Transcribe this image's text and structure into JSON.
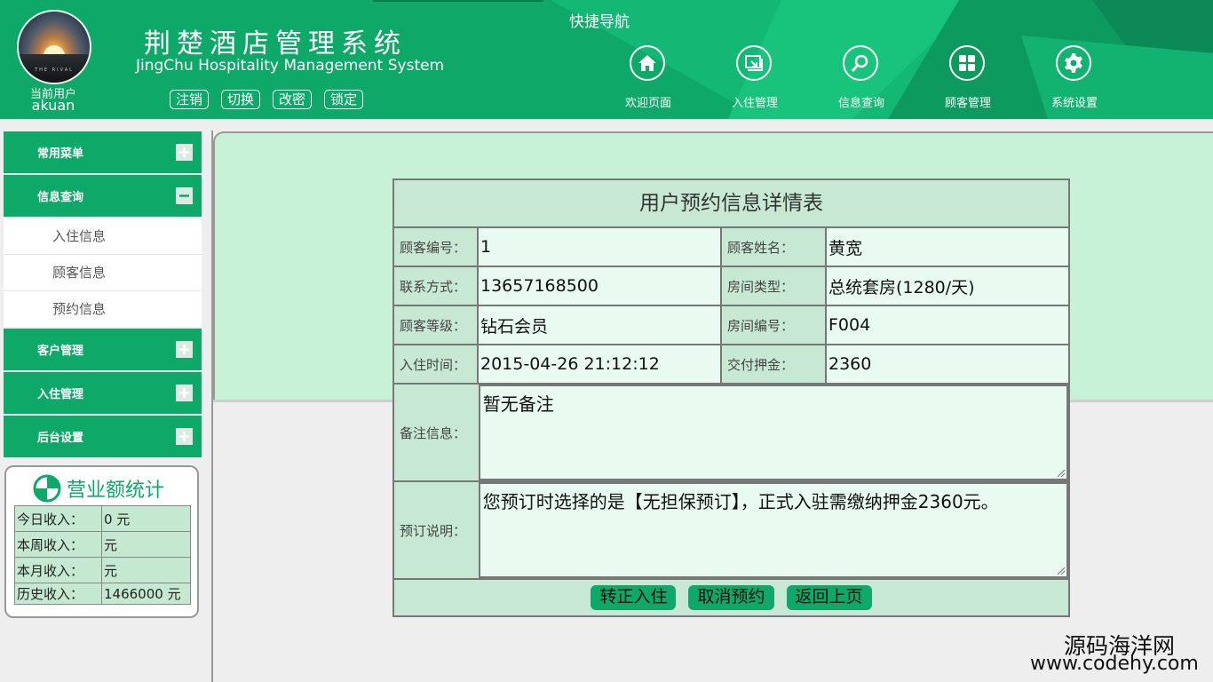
{
  "header": {
    "current_user_label": "当前用户",
    "current_user_name": "akuan",
    "avatar_tag": "THE RIVAL",
    "title": "荆楚酒店管理系统",
    "subtitle": "JingChu Hospitality Management System",
    "user_buttons": [
      "注销",
      "切换",
      "改密",
      "锁定"
    ],
    "quick_nav_title": "快捷导航",
    "nav": [
      {
        "label": "欢迎页面",
        "icon": "home-icon"
      },
      {
        "label": "入住管理",
        "icon": "checkin-icon"
      },
      {
        "label": "信息查询",
        "icon": "search-icon"
      },
      {
        "label": "顾客管理",
        "icon": "grid-icon"
      },
      {
        "label": "系统设置",
        "icon": "gear-icon"
      }
    ]
  },
  "sidebar": {
    "menus": [
      {
        "label": "常用菜单",
        "expanded": false
      },
      {
        "label": "信息查询",
        "expanded": true,
        "items": [
          "入住信息",
          "顾客信息",
          "预约信息"
        ]
      },
      {
        "label": "客户管理",
        "expanded": false
      },
      {
        "label": "入住管理",
        "expanded": false
      },
      {
        "label": "后台设置",
        "expanded": false
      }
    ],
    "stats": {
      "title": "营业额统计",
      "rows": [
        {
          "label": "今日收入：",
          "value": "0 元"
        },
        {
          "label": "本周收入：",
          "value": "元"
        },
        {
          "label": "本月收入：",
          "value": "元"
        },
        {
          "label": "历史收入：",
          "value": "1466000 元"
        }
      ]
    }
  },
  "detail": {
    "caption": "用户预约信息详情表",
    "rows": [
      {
        "l1": "顾客编号：",
        "v1": "1",
        "l2": "顾客姓名：",
        "v2": "黄宽"
      },
      {
        "l1": "联系方式：",
        "v1": "13657168500",
        "l2": "房间类型：",
        "v2": "总统套房(1280/天)"
      },
      {
        "l1": "顾客等级：",
        "v1": "钻石会员",
        "l2": "房间编号：",
        "v2": "F004"
      },
      {
        "l1": "入住时间：",
        "v1": "2015-04-26 21:12:12",
        "l2": "交付押金：",
        "v2": "2360"
      }
    ],
    "remark_label": "备注信息：",
    "remark_value": "暂无备注",
    "booking_label": "预订说明：",
    "booking_value": "您预订时选择的是【无担保预订】，正式入驻需缴纳押金2360元。",
    "buttons": [
      "转正入住",
      "取消预约",
      "返回上页"
    ]
  },
  "watermark": {
    "line1": "源码海洋网",
    "line2": "www.codehy.com"
  },
  "colors": {
    "brand_green": "#0ea968",
    "panel_green": "#c8f2d8",
    "cell_green": "#c7e8d2",
    "value_green": "#e9fbf0"
  }
}
